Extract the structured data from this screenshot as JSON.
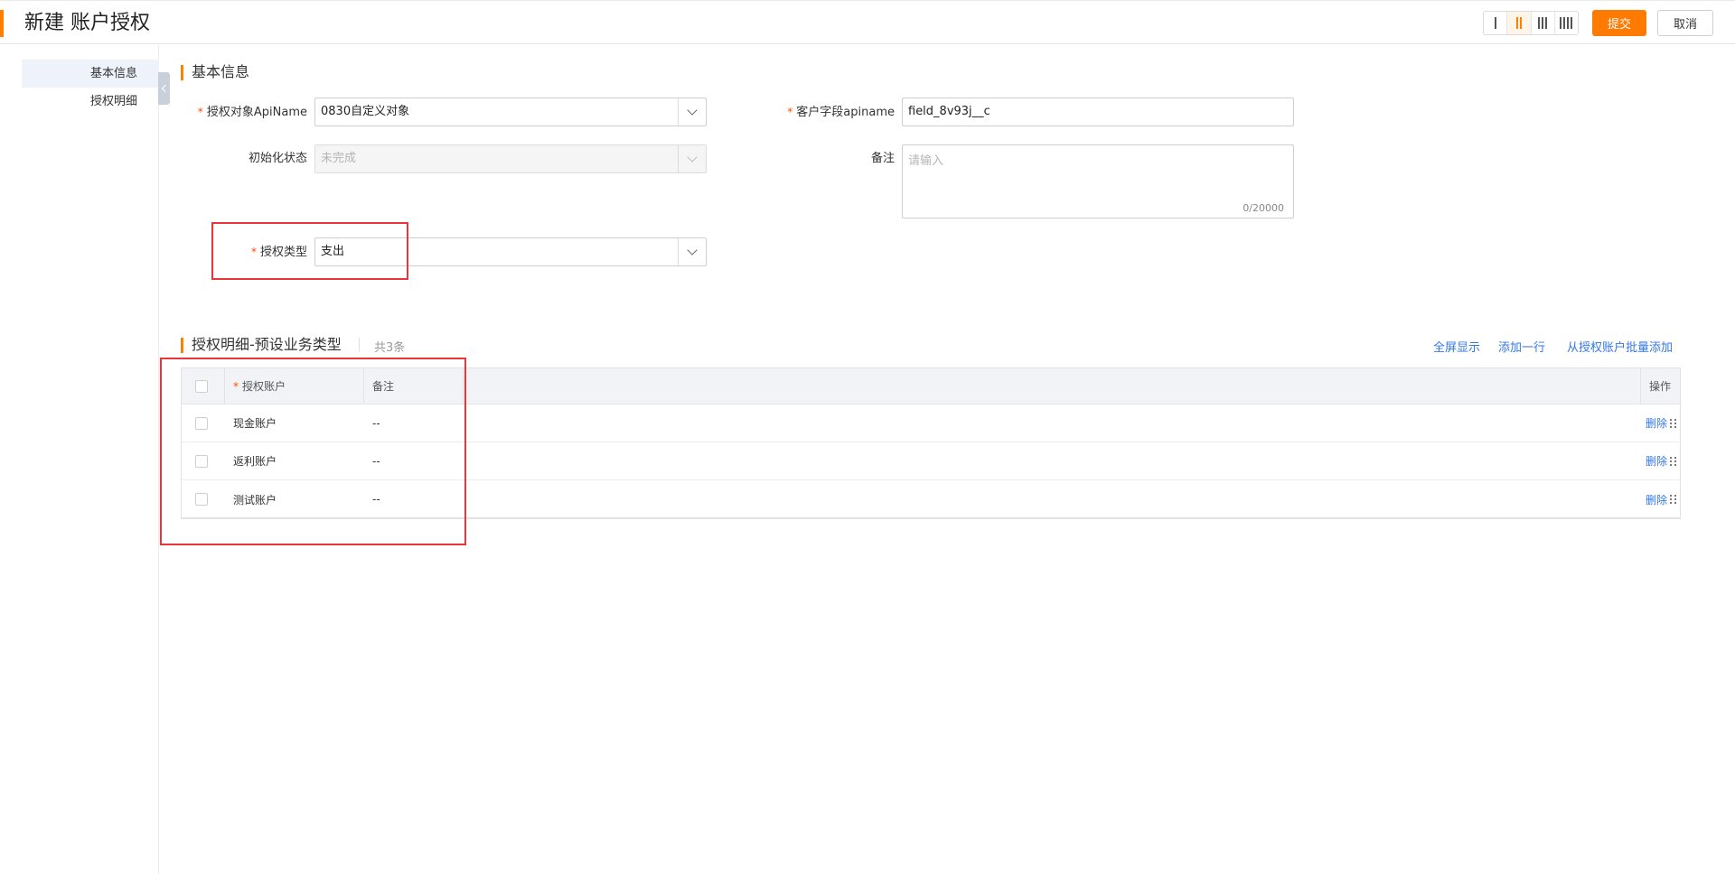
{
  "header": {
    "title": "新建 账户授权",
    "submit_label": "提交",
    "cancel_label": "取消",
    "layout_options": [
      {
        "name": "one-column",
        "bars": 1,
        "active": false
      },
      {
        "name": "two-column",
        "bars": 2,
        "active": true
      },
      {
        "name": "three-column",
        "bars": 3,
        "active": false
      },
      {
        "name": "four-column",
        "bars": 4,
        "active": false
      }
    ]
  },
  "nav": {
    "items": [
      {
        "label": "基本信息",
        "active": true
      },
      {
        "label": "授权明细",
        "active": false
      }
    ]
  },
  "basic": {
    "section_title": "基本信息",
    "auth_object": {
      "label": "授权对象ApiName",
      "required": true,
      "value": "0830自定义对象"
    },
    "customer_field": {
      "label": "客户字段apiname",
      "required": true,
      "value": "field_8v93j__c"
    },
    "init_status": {
      "label": "初始化状态",
      "required": false,
      "value": "未完成",
      "disabled": true
    },
    "remark": {
      "label": "备注",
      "placeholder": "请输入",
      "counter": "0/20000"
    },
    "auth_type": {
      "label": "授权类型",
      "required": true,
      "value": "支出"
    }
  },
  "detail": {
    "section_title": "授权明细-预设业务类型",
    "count_text": "共3条",
    "links": {
      "fullscreen": "全屏显示",
      "add_row": "添加一行",
      "batch_add": "从授权账户批量添加"
    },
    "columns": {
      "account": "授权账户",
      "remark": "备注",
      "op": "操作"
    },
    "rows": [
      {
        "account": "现金账户",
        "remark": "--",
        "op": "删除"
      },
      {
        "account": "返利账户",
        "remark": "--",
        "op": "删除"
      },
      {
        "account": "测试账户",
        "remark": "--",
        "op": "删除"
      }
    ]
  },
  "colors": {
    "accent": "#ff8000",
    "link": "#3478e5",
    "highlight": "#e8363b"
  }
}
